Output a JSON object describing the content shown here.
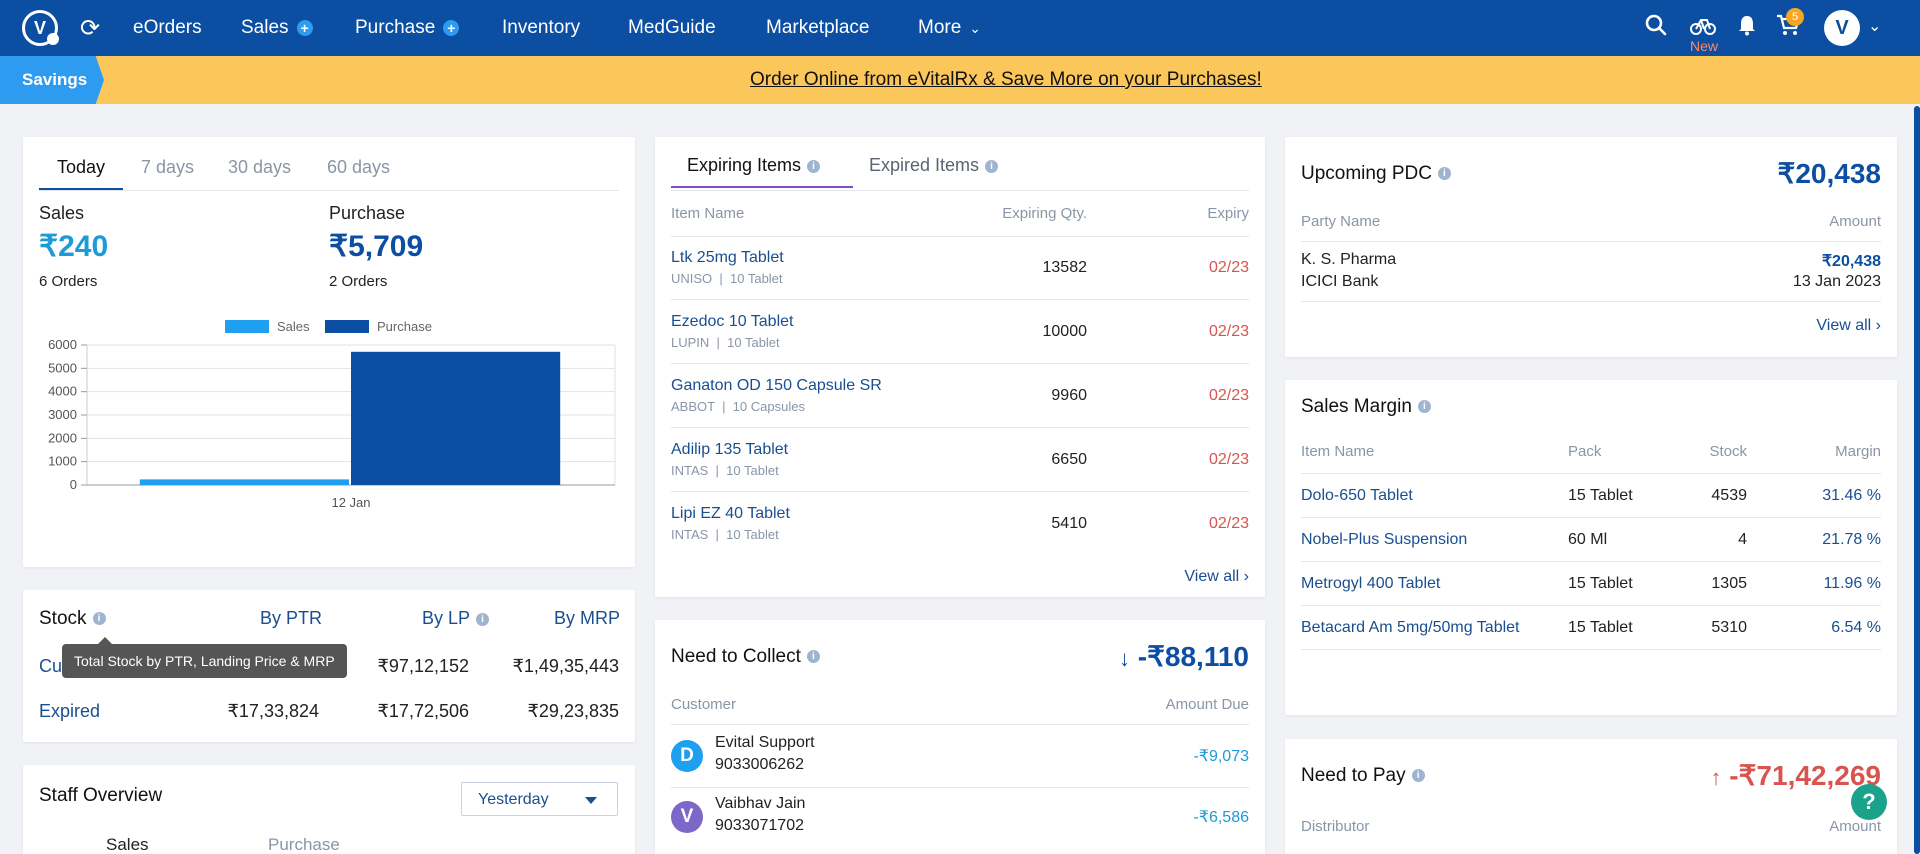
{
  "nav": {
    "items": [
      "eOrders",
      "Sales",
      "Purchase",
      "Inventory",
      "MedGuide",
      "Marketplace",
      "More"
    ],
    "new_label": "New",
    "cart_count": "5",
    "avatar_letter": "V"
  },
  "banner": {
    "tag": "Savings",
    "link": "Order Online from eVitalRx & Save More on your Purchases!"
  },
  "summary": {
    "tabs": [
      "Today",
      "7 days",
      "30 days",
      "60 days"
    ],
    "sales_label": "Sales",
    "sales_value": "₹240",
    "sales_orders": "6 Orders",
    "purchase_label": "Purchase",
    "purchase_value": "₹5,709",
    "purchase_orders": "2 Orders"
  },
  "chart_data": {
    "type": "bar",
    "categories": [
      "12 Jan"
    ],
    "series": [
      {
        "name": "Sales",
        "values": [
          240
        ],
        "color": "#1e9ff0"
      },
      {
        "name": "Purchase",
        "values": [
          5709
        ],
        "color": "#0b4ea2"
      }
    ],
    "ylim": [
      0,
      6000
    ],
    "yticks": [
      "6000",
      "5000",
      "4000",
      "3000",
      "2000",
      "1000",
      "0"
    ],
    "legend": "top"
  },
  "stock": {
    "title": "Stock",
    "headers": [
      "By PTR",
      "By LP",
      "By MRP"
    ],
    "current_label": "Cu",
    "current": [
      "₹97,12,152",
      "₹1,49,35,443"
    ],
    "expired_label": "Expired",
    "expired": [
      "₹17,33,824",
      "₹17,72,506",
      "₹29,23,835"
    ],
    "tooltip": "Total Stock by PTR, Landing Price & MRP"
  },
  "staff": {
    "title": "Staff Overview",
    "period": "Yesterday",
    "tabs": [
      "Sales",
      "Purchase"
    ]
  },
  "expiring": {
    "tab_active": "Expiring Items",
    "tab_other": "Expired Items",
    "headers": [
      "Item Name",
      "Expiring Qty.",
      "Expiry"
    ],
    "rows": [
      {
        "name": "Ltk 25mg Tablet",
        "sub1": "UNISO",
        "sub2": "10 Tablet",
        "qty": "13582",
        "expiry": "02/23"
      },
      {
        "name": "Ezedoc 10 Tablet",
        "sub1": "LUPIN",
        "sub2": "10 Tablet",
        "qty": "10000",
        "expiry": "02/23"
      },
      {
        "name": "Ganaton OD 150 Capsule SR",
        "sub1": "ABBOT",
        "sub2": "10 Capsules",
        "qty": "9960",
        "expiry": "02/23"
      },
      {
        "name": "Adilip 135 Tablet",
        "sub1": "INTAS",
        "sub2": "10 Tablet",
        "qty": "6650",
        "expiry": "02/23"
      },
      {
        "name": "Lipi EZ 40 Tablet",
        "sub1": "INTAS",
        "sub2": "10 Tablet",
        "qty": "5410",
        "expiry": "02/23"
      }
    ],
    "view_all": "View all"
  },
  "collect": {
    "title": "Need to Collect",
    "total": "-₹88,110",
    "headers": [
      "Customer",
      "Amount Due"
    ],
    "rows": [
      {
        "initial": "D",
        "name": "Evital Support",
        "phone": "9033006262",
        "amount": "-₹9,073",
        "color": "#1e9ff0"
      },
      {
        "initial": "V",
        "name": "Vaibhav Jain",
        "phone": "9033071702",
        "amount": "-₹6,586",
        "color": "#7b68c9"
      }
    ]
  },
  "pdc": {
    "title": "Upcoming PDC",
    "total": "₹20,438",
    "headers": [
      "Party Name",
      "Amount"
    ],
    "party": "K. S. Pharma",
    "bank": "ICICI Bank",
    "amount": "₹20,438",
    "date": "13 Jan 2023",
    "view_all": "View all"
  },
  "margin": {
    "title": "Sales Margin",
    "headers": [
      "Item Name",
      "Pack",
      "Stock",
      "Margin"
    ],
    "rows": [
      {
        "name": "Dolo-650 Tablet",
        "pack": "15 Tablet",
        "stock": "4539",
        "margin": "31.46 %"
      },
      {
        "name": "Nobel-Plus Suspension",
        "pack": "60 Ml",
        "stock": "4",
        "margin": "21.78 %"
      },
      {
        "name": "Metrogyl 400 Tablet",
        "pack": "15 Tablet",
        "stock": "1305",
        "margin": "11.96 %"
      },
      {
        "name": "Betacard Am 5mg/50mg Tablet",
        "pack": "15 Tablet",
        "stock": "5310",
        "margin": "6.54 %"
      }
    ]
  },
  "pay": {
    "title": "Need to Pay",
    "total": "-₹71,42,269",
    "headers": [
      "Distributor",
      "Amount"
    ]
  }
}
